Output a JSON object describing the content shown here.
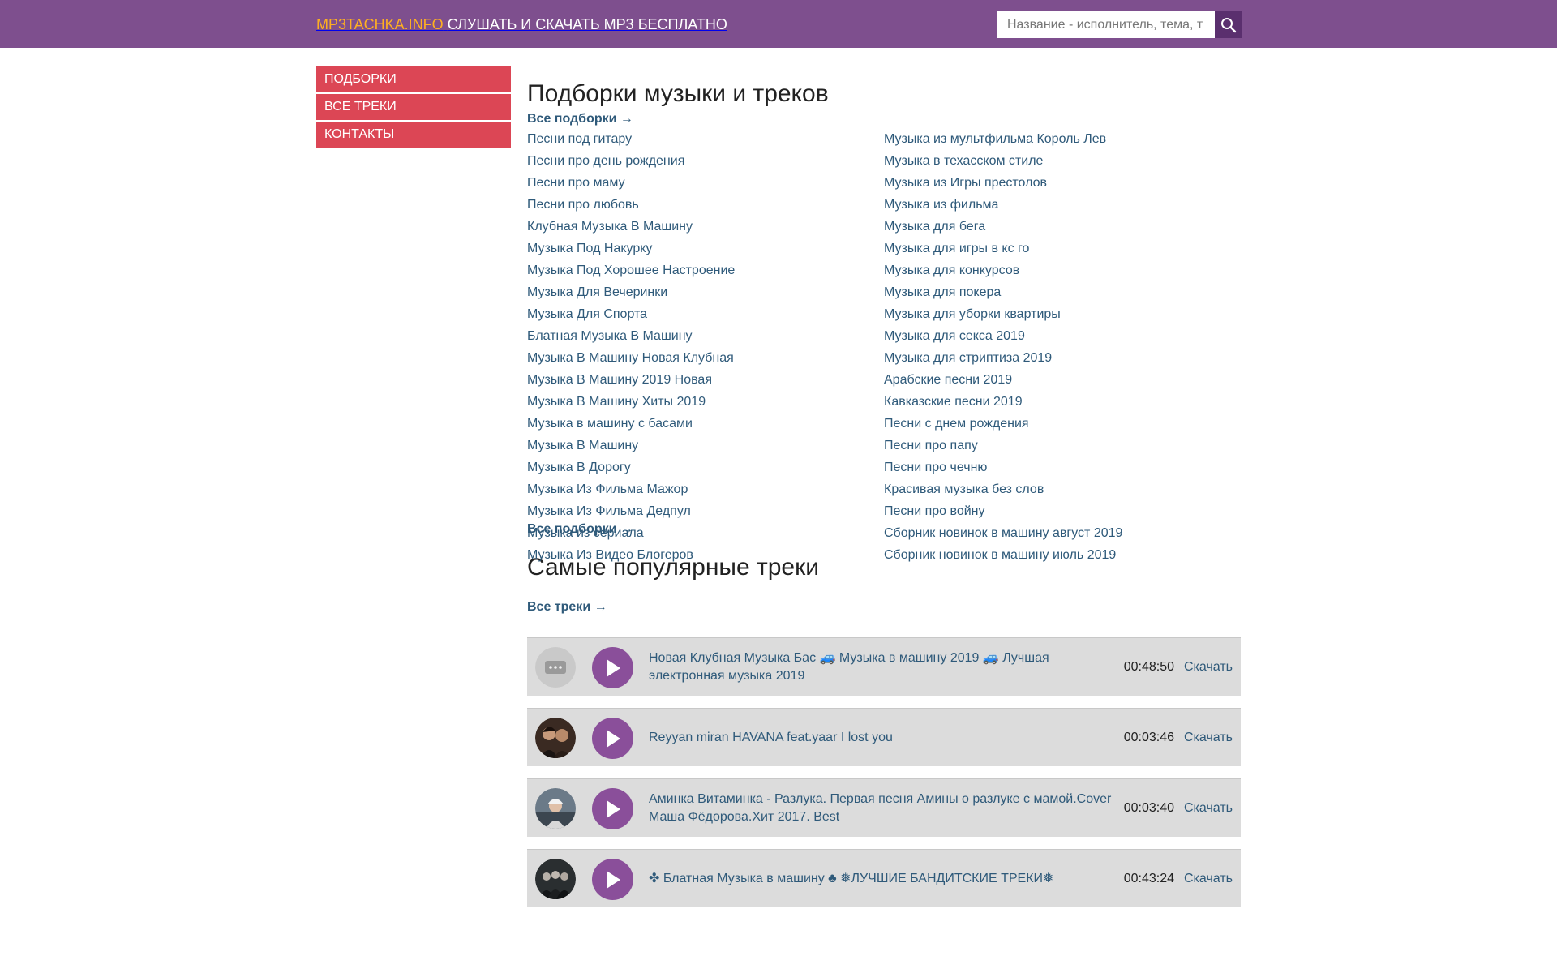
{
  "header": {
    "brand": "MP3TACHKA.INFO",
    "tagline": "СЛУШАТЬ И СКАЧАТЬ MP3 БЕСПЛАТНО",
    "search_placeholder": "Название - исполнитель, тема, т",
    "search_icon": "search-icon",
    "colors": {
      "bar": "#7e4f8e",
      "brand": "#ffb020",
      "search_button": "#5a2f6e"
    }
  },
  "sidebar": {
    "items": [
      {
        "label": "ПОДБОРКИ"
      },
      {
        "label": "ВСЕ ТРЕКИ"
      },
      {
        "label": "КОНТАКТЫ"
      }
    ],
    "color": "#dc4655"
  },
  "collections": {
    "title": "Подборки музыки и треков",
    "all_link_top": "Все подборки →",
    "all_link_bottom": "Все подборки →",
    "left": [
      "Песни под гитару",
      "Песни про день рождения",
      "Песни про маму",
      "Песни про любовь",
      "Клубная Музыка В Машину",
      "Музыка Под Накурку",
      "Музыка Под Хорошее Настроение",
      "Музыка Для Вечеринки",
      "Музыка Для Спорта",
      "Блатная Музыка В Машину",
      "Музыка В Машину Новая Клубная",
      "Музыка В Машину 2019 Новая",
      "Музыка В Машину Хиты 2019",
      "Музыка в машину с басами",
      "Музыка В Машину",
      "Музыка В Дорогу",
      "Музыка Из Фильма Мажор",
      "Музыка Из Фильма Дедпул",
      "Музыка из сериала",
      "Музыка Из Видео Блогеров"
    ],
    "right": [
      "Музыка из мультфильма Король Лев",
      "Музыка в техасском стиле",
      "Музыка из Игры престолов",
      "Музыка из фильма",
      "Музыка для бега",
      "Музыка для игры в кс го",
      "Музыка для конкурсов",
      "Музыка для покера",
      "Музыка для уборки квартиры",
      "Музыка для секса 2019",
      "Музыка для стриптиза 2019",
      "Арабские песни 2019",
      "Кавказские песни 2019",
      "Песни с днем рождения",
      "Песни про папу",
      "Песни про чечню",
      "Красивая музыка без слов",
      "Песни про войну",
      "Сборник новинок в машину август 2019",
      "Сборник новинок в машину июль 2019"
    ]
  },
  "popular": {
    "title": "Самые популярные треки",
    "all_link": "Все треки →",
    "download_label": "Скачать",
    "tracks": [
      {
        "title": "Новая Клубная Музыка Бас 🚙 Музыка в машину 2019 🚙 Лучшая электронная музыка 2019",
        "duration": "00:48:50",
        "cover": "placeholder-icon"
      },
      {
        "title": "Reyyan miran HAVANA feat.yaar I lost you",
        "duration": "00:03:46",
        "cover": "avatar-couple"
      },
      {
        "title": "Аминка Витаминка - Разлука. Первая песня Амины о разлуке с мамой.Cover Маша Фёдорова.Хит 2017. Best",
        "duration": "00:03:40",
        "cover": "avatar-girl"
      },
      {
        "title": "✤ Блатная Музыка в машину ♣ ❅ЛУЧШИЕ БАНДИТСКИЕ ТРЕКИ❅",
        "duration": "00:43:24",
        "cover": "avatar-group"
      }
    ]
  }
}
